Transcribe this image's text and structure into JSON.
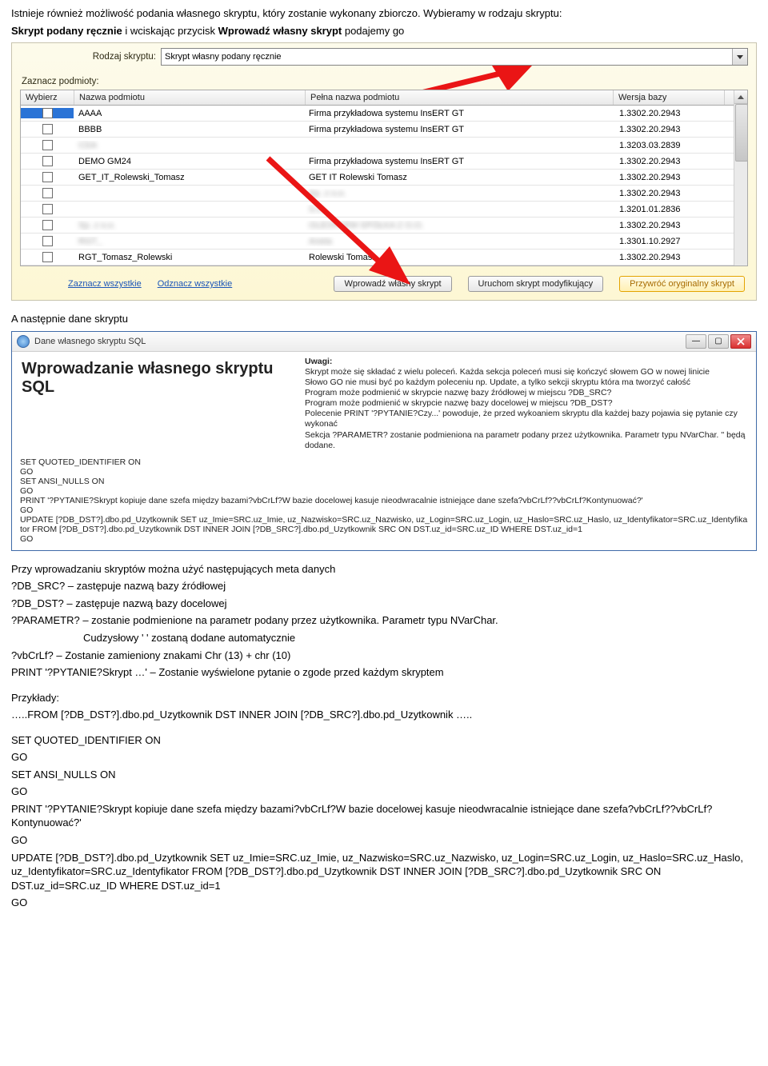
{
  "intro1": "Istnieje również możliwość podania własnego skryptu, który zostanie wykonany zbiorczo. Wybieramy w rodzaju skryptu: ",
  "intro2a": "Skrypt podany ręcznie",
  "intro2b": " i wciskając przycisk ",
  "intro2c": "Wprowadź własny skrypt",
  "intro2d": " podajemy go",
  "panel1": {
    "rodzaj_lbl": "Rodzaj skryptu:",
    "rodzaj_val": "Skrypt własny podany ręcznie",
    "zaz": "Zaznacz podmioty:",
    "head_wyb": "Wybierz",
    "head_nazwa": "Nazwa podmiotu",
    "head_pelna": "Pełna nazwa podmiotu",
    "head_wer": "Wersja bazy",
    "rows": [
      {
        "n": "AAAA",
        "p": "Firma przykładowa systemu InsERT GT",
        "w": "1.3302.20.2943",
        "sel": true
      },
      {
        "n": "BBBB",
        "p": "Firma przykładowa systemu InsERT GT",
        "w": "1.3302.20.2943"
      },
      {
        "n": "CDA",
        "p": "",
        "w": "1.3203.03.2839",
        "blur": true
      },
      {
        "n": "DEMO GM24",
        "p": "Firma przykładowa systemu InsERT GT",
        "w": "1.3302.20.2943"
      },
      {
        "n": "GET_IT_Rolewski_Tomasz",
        "p": "GET IT Rolewski Tomasz",
        "w": "1.3302.20.2943"
      },
      {
        "n": "",
        "p": " Sp. z o.o.",
        "w": "1.3302.20.2943",
        "blur": true
      },
      {
        "n": "",
        "p": " S.C. ",
        "w": "1.3201.01.2836",
        "blur": true
      },
      {
        "n": " Sp. z o.o.",
        "p": "OLEOFARM SPÓŁKA Z O.O.",
        "w": "1.3302.20.2943",
        "blur": true
      },
      {
        "n": "RGT_",
        "p": "Aneta ",
        "w": "1.3301.10.2927",
        "blur": true
      },
      {
        "n": "RGT_Tomasz_Rolewski",
        "p": "Rolewski Tomasz",
        "w": "1.3302.20.2943"
      }
    ],
    "link_zaz": "Zaznacz wszystkie",
    "link_odz": "Odznacz wszystkie",
    "btn_wpr": "Wprowadź własny skrypt",
    "btn_uru": "Uruchom skrypt modyfikujący",
    "btn_prz": "Przywróć oryginalny skrypt"
  },
  "mid": "A następnie dane skryptu",
  "panel2": {
    "title": "Dane własnego skryptu SQL",
    "heading": "Wprowadzanie własnego skryptu SQL",
    "uwagi_h": "Uwagi:",
    "u1": "Skrypt może się składać z wielu poleceń. Każda sekcja poleceń musi się kończyć słowem GO w nowej linicie",
    "u2": "Słowo GO nie musi być po każdym poleceniu np. Update, a tylko sekcji skryptu która ma tworzyć całość",
    "u3": "Program może podmienić w skrypcie nazwę bazy źródłowej w miejscu ?DB_SRC?",
    "u4": "Program może podmienić w skrypcie nazwę bazy docelowej w miejscu  ?DB_DST?",
    "u5": "Polecenie PRINT '?PYTANIE?Czy...' powoduje, że przed wykoaniem skryptu dla każdej bazy pojawia się pytanie czy wykonać",
    "u6": "Sekcja ?PARAMETR? zostanie podmieniona na parametr podany przez użytkownika. Parametr typu NVarChar. '' będą dodane.",
    "sql": "SET QUOTED_IDENTIFIER ON\nGO\nSET ANSI_NULLS ON\nGO\nPRINT '?PYTANIE?Skrypt kopiuje dane szefa między bazami?vbCrLf?W bazie docelowej kasuje nieodwracalnie istniejące dane szefa?vbCrLf??vbCrLf?Kontynuować?'\nGO\nUPDATE [?DB_DST?].dbo.pd_Uzytkownik SET uz_Imie=SRC.uz_Imie, uz_Nazwisko=SRC.uz_Nazwisko, uz_Login=SRC.uz_Login, uz_Haslo=SRC.uz_Haslo, uz_Identyfikator=SRC.uz_Identyfikator FROM [?DB_DST?].dbo.pd_Uzytkownik DST INNER JOIN [?DB_SRC?].dbo.pd_Uzytkownik SRC ON DST.uz_id=SRC.uz_ID WHERE DST.uz_id=1\nGO"
  },
  "after1": "Przy wprowadzaniu skryptów można użyć następujących meta danych",
  "meta": {
    "l1": "?DB_SRC? – zastępuje nazwą bazy źródłowej",
    "l2": "?DB_DST? – zastępuje nazwą bazy docelowej",
    "l3": "?PARAMETR? – zostanie podmienione na parametr podany przez użytkownika. Parametr typu NVarChar.",
    "l3b": "Cudzysłowy ' ' zostaną dodane automatycznie",
    "l4": "?vbCrLf? – Zostanie zamieniony znakami Chr (13) + chr (10)",
    "l5": "PRINT '?PYTANIE?Skrypt …' – Zostanie wyświelone pytanie o zgode przed każdym skryptem"
  },
  "ex_h": "Przykłady:",
  "ex1": "…..FROM [?DB_DST?].dbo.pd_Uzytkownik DST INNER JOIN [?DB_SRC?].dbo.pd_Uzytkownik …..",
  "code": {
    "l1": "SET QUOTED_IDENTIFIER ON",
    "l2": "GO",
    "l3": "SET ANSI_NULLS ON",
    "l4": "GO",
    "l5": "PRINT '?PYTANIE?Skrypt kopiuje dane szefa między bazami?vbCrLf?W bazie docelowej kasuje nieodwracalnie istniejące dane szefa?vbCrLf??vbCrLf?Kontynuować?'",
    "l6": "GO",
    "l7": "UPDATE [?DB_DST?].dbo.pd_Uzytkownik SET uz_Imie=SRC.uz_Imie, uz_Nazwisko=SRC.uz_Nazwisko, uz_Login=SRC.uz_Login, uz_Haslo=SRC.uz_Haslo, uz_Identyfikator=SRC.uz_Identyfikator FROM [?DB_DST?].dbo.pd_Uzytkownik DST INNER JOIN [?DB_SRC?].dbo.pd_Uzytkownik SRC ON DST.uz_id=SRC.uz_ID WHERE DST.uz_id=1",
    "l8": "GO"
  }
}
